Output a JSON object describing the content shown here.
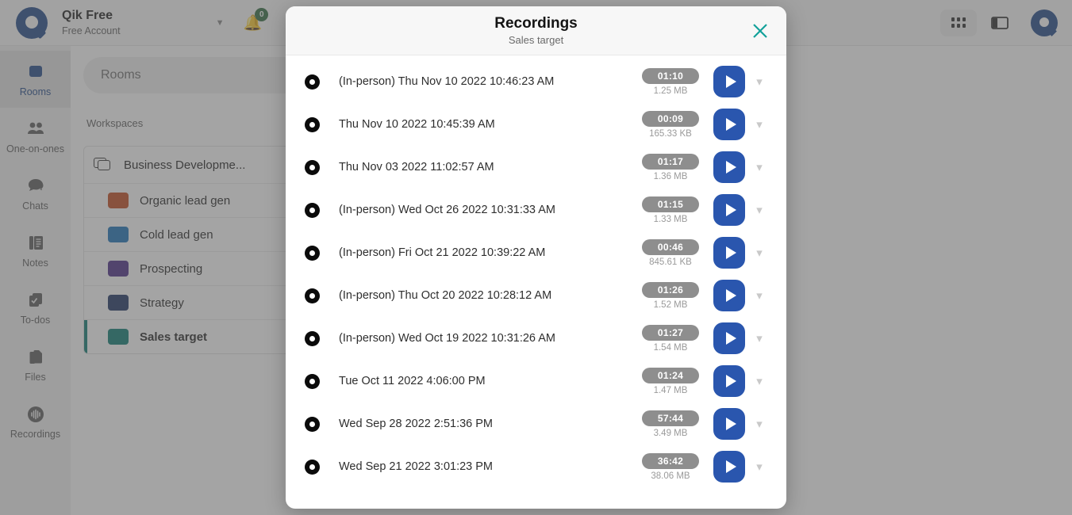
{
  "topbar": {
    "brand_title": "Qik Free",
    "brand_subtitle": "Free Account",
    "caret_icon": "chevron-down-icon",
    "bell_icon": "bell-icon",
    "bell_badge": "0",
    "search_placeholder": "Rooms",
    "grid_icon": "grid-apps-icon",
    "panel_icon": "side-panel-icon",
    "avatar_icon": "user-avatar-icon"
  },
  "rail": {
    "items": [
      {
        "label": "Rooms",
        "icon": "rooms-icon",
        "active": true
      },
      {
        "label": "One-on-ones",
        "icon": "people-icon",
        "active": false
      },
      {
        "label": "Chats",
        "icon": "chat-bubble-icon",
        "active": false
      },
      {
        "label": "Notes",
        "icon": "notes-icon",
        "active": false
      },
      {
        "label": "To-dos",
        "icon": "checkbox-icon",
        "active": false
      },
      {
        "label": "Files",
        "icon": "files-icon",
        "active": false
      },
      {
        "label": "Recordings",
        "icon": "waveform-icon",
        "active": false
      }
    ]
  },
  "workspaces": {
    "search_placeholder": "Rooms",
    "section_label": "Workspaces",
    "add_label": "+",
    "group": {
      "name": "Business Developme...",
      "folder_icon": "folder-stack-icon",
      "clock_icon": "clock-icon",
      "grid_icon": "grid-icon"
    },
    "rooms": [
      {
        "name": "Organic lead gen",
        "color": "#c2491d",
        "selected": false
      },
      {
        "name": "Cold lead gen",
        "color": "#1a72b8",
        "selected": false
      },
      {
        "name": "Prospecting",
        "color": "#4b2a86",
        "selected": false
      },
      {
        "name": "Strategy",
        "color": "#1c3263",
        "selected": false
      },
      {
        "name": "Sales target",
        "color": "#0b7b72",
        "selected": true
      }
    ]
  },
  "modal": {
    "title": "Recordings",
    "subtitle": "Sales target",
    "close_icon": "close-icon",
    "close_color": "#12a19a",
    "play_color": "#2a56ae",
    "recordings": [
      {
        "name": "(In-person) Thu Nov 10 2022 10:46:23 AM",
        "duration": "01:10",
        "size": "1.25 MB",
        "record_icon": "record-dot-icon",
        "play_icon": "play-icon",
        "expand_icon": "chevron-down-icon"
      },
      {
        "name": "Thu Nov 10 2022 10:45:39 AM",
        "duration": "00:09",
        "size": "165.33 KB",
        "record_icon": "record-dot-icon",
        "play_icon": "play-icon",
        "expand_icon": "chevron-down-icon"
      },
      {
        "name": "Thu Nov 03 2022 11:02:57 AM",
        "duration": "01:17",
        "size": "1.36 MB",
        "record_icon": "record-dot-icon",
        "play_icon": "play-icon",
        "expand_icon": "chevron-down-icon"
      },
      {
        "name": "(In-person) Wed Oct 26 2022 10:31:33 AM",
        "duration": "01:15",
        "size": "1.33 MB",
        "record_icon": "record-dot-icon",
        "play_icon": "play-icon",
        "expand_icon": "chevron-down-icon"
      },
      {
        "name": "(In-person) Fri Oct 21 2022 10:39:22 AM",
        "duration": "00:46",
        "size": "845.61 KB",
        "record_icon": "record-dot-icon",
        "play_icon": "play-icon",
        "expand_icon": "chevron-down-icon"
      },
      {
        "name": "(In-person) Thu Oct 20 2022 10:28:12 AM",
        "duration": "01:26",
        "size": "1.52 MB",
        "record_icon": "record-dot-icon",
        "play_icon": "play-icon",
        "expand_icon": "chevron-down-icon"
      },
      {
        "name": "(In-person) Wed Oct 19 2022 10:31:26 AM",
        "duration": "01:27",
        "size": "1.54 MB",
        "record_icon": "record-dot-icon",
        "play_icon": "play-icon",
        "expand_icon": "chevron-down-icon"
      },
      {
        "name": "Tue Oct 11 2022 4:06:00 PM",
        "duration": "01:24",
        "size": "1.47 MB",
        "record_icon": "record-dot-icon",
        "play_icon": "play-icon",
        "expand_icon": "chevron-down-icon"
      },
      {
        "name": "Wed Sep 28 2022 2:51:36 PM",
        "duration": "57:44",
        "size": "3.49 MB",
        "record_icon": "record-dot-icon",
        "play_icon": "play-icon",
        "expand_icon": "chevron-down-icon"
      },
      {
        "name": "Wed Sep 21 2022 3:01:23 PM",
        "duration": "36:42",
        "size": "38.06 MB",
        "record_icon": "record-dot-icon",
        "play_icon": "play-icon",
        "expand_icon": "chevron-down-icon"
      }
    ]
  }
}
